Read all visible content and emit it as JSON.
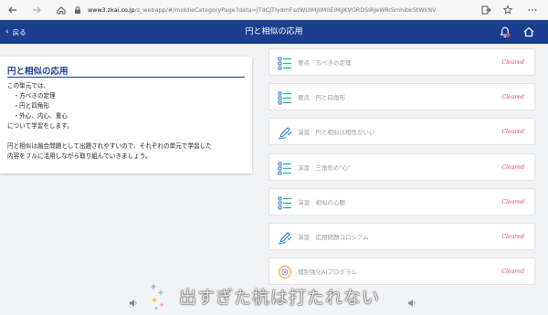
{
  "browser": {
    "url_host": "www3.zkai.co.jp",
    "url_path": "/z_webapp/#/middleCategoryPage?data=JTdCJTIydmFsdWUlMjIlM0ElMjJKVGRDSlRJeWRISmhibk5tWkNV",
    "icons": [
      "back-arrow-icon",
      "forward-arrow-icon",
      "home-icon",
      "lock-icon",
      "exit-icon",
      "star-icon",
      "more-icon"
    ]
  },
  "header": {
    "back_label": "戻る",
    "title": "円と相似の応用",
    "color": "#1a3f91"
  },
  "info": {
    "title": "円と相似の応用",
    "lines": [
      "この単元では、",
      "　・方べきの定理",
      "　・円と四角形",
      "　・外心、内心、重心",
      "について学習をします。",
      "",
      "円と相似は融合問題として出題されやすいので、それぞれの単元で学習した",
      "内容をフルに活用しながら取り組んでいきましょう。"
    ]
  },
  "lessons": [
    {
      "icon": "list-icon",
      "label": "要点　方べきの定理",
      "status": "Cleared"
    },
    {
      "icon": "list-icon",
      "label": "要点　円と四角形",
      "status": "Cleared"
    },
    {
      "icon": "pencil-icon",
      "label": "演習　円と相似は相性がいい",
      "status": "Cleared"
    },
    {
      "icon": "list-icon",
      "label": "演習　三角形の\"心\"",
      "status": "Cleared"
    },
    {
      "icon": "list-icon",
      "label": "演習　相似の心眼",
      "status": "Cleared"
    },
    {
      "icon": "pencil-icon",
      "label": "演習　応用問題コロシアム",
      "status": "Cleared"
    },
    {
      "icon": "ai-program-icon",
      "label": "個別強化AIプログラム",
      "status": "Cleared"
    }
  ],
  "caption": "出すぎた杭は打たれない",
  "colors": {
    "accent": "#1a3f91",
    "cleared": "#e8446b",
    "icon_teal": "#2bb3a6"
  }
}
